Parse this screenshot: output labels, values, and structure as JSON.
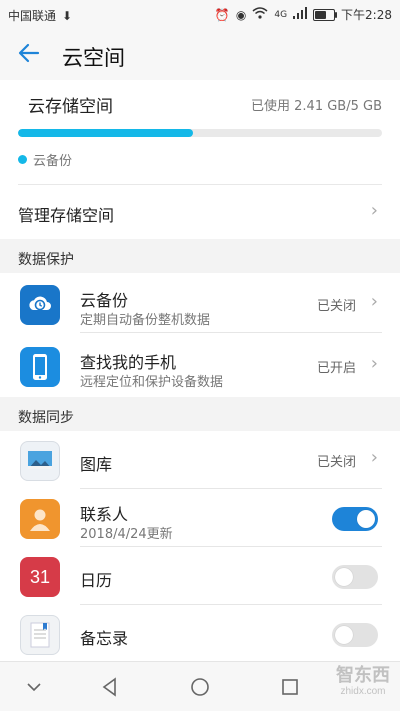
{
  "status_bar": {
    "carrier": "中国联通",
    "time": "下午2:28",
    "network": "4G",
    "battery_level": 0.6
  },
  "header": {
    "title": "云空间"
  },
  "storage": {
    "title": "云存储空间",
    "used_text": "已使用 2.41 GB/5 GB",
    "used_fraction": 0.482,
    "legend_label": "云备份",
    "accent_color": "#14b8e8",
    "manage_label": "管理存储空间"
  },
  "sections": {
    "protection": {
      "title": "数据保护",
      "items": [
        {
          "title": "云备份",
          "subtitle": "定期自动备份整机数据",
          "value": "已关闭",
          "icon": "cloud-backup-icon"
        },
        {
          "title": "查找我的手机",
          "subtitle": "远程定位和保护设备数据",
          "value": "已开启",
          "icon": "find-phone-icon"
        }
      ]
    },
    "sync": {
      "title": "数据同步",
      "items": [
        {
          "title": "图库",
          "subtitle": "",
          "value": "已关闭",
          "type": "chevron",
          "icon": "gallery-icon"
        },
        {
          "title": "联系人",
          "subtitle": "2018/4/24更新",
          "type": "toggle",
          "enabled": true,
          "icon": "contacts-icon"
        },
        {
          "title": "日历",
          "subtitle": "",
          "type": "toggle",
          "enabled": false,
          "icon": "calendar-icon",
          "calendar_day": "31"
        },
        {
          "title": "备忘录",
          "subtitle": "",
          "type": "toggle",
          "enabled": false,
          "icon": "notes-icon"
        }
      ]
    }
  },
  "watermark": {
    "text": "智东西",
    "subtext": "zhidx.com"
  }
}
